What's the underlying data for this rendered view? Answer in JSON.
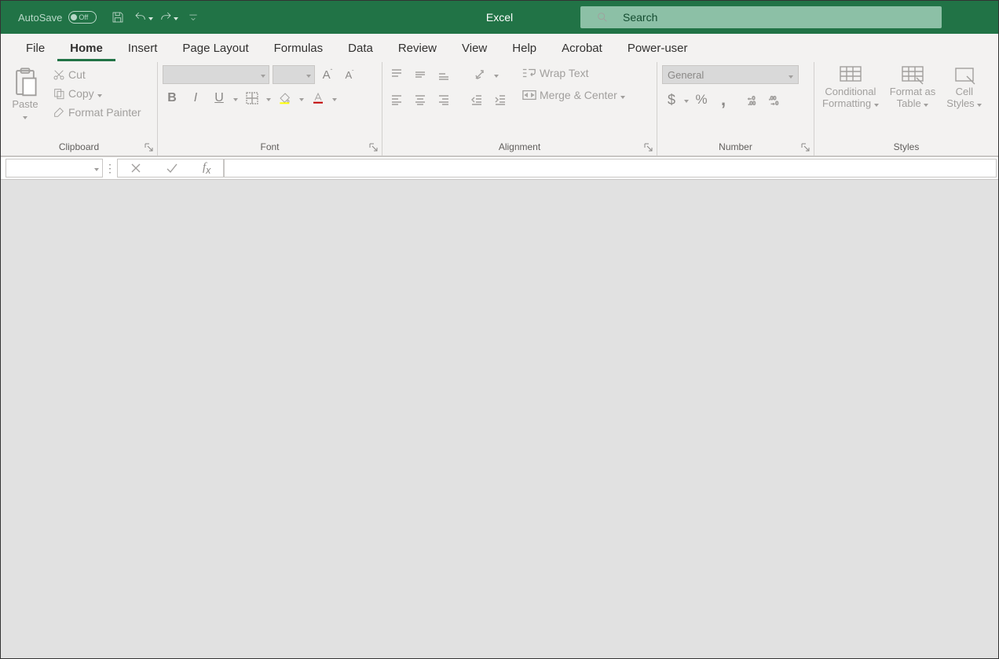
{
  "title": "Excel",
  "autosave": {
    "label": "AutoSave",
    "state": "Off"
  },
  "search": {
    "placeholder": "Search"
  },
  "tabs": [
    "File",
    "Home",
    "Insert",
    "Page Layout",
    "Formulas",
    "Data",
    "Review",
    "View",
    "Help",
    "Acrobat",
    "Power-user"
  ],
  "active_tab": "Home",
  "groups": {
    "clipboard": {
      "label": "Clipboard",
      "paste": "Paste",
      "cut": "Cut",
      "copy": "Copy",
      "format_painter": "Format Painter"
    },
    "font": {
      "label": "Font"
    },
    "alignment": {
      "label": "Alignment",
      "wrap": "Wrap Text",
      "merge": "Merge & Center"
    },
    "number": {
      "label": "Number",
      "format": "General"
    },
    "styles": {
      "label": "Styles",
      "cond": "Conditional",
      "cond2": "Formatting",
      "fmt": "Format as",
      "fmt2": "Table",
      "cell": "Cell",
      "cell2": "Styles"
    }
  }
}
